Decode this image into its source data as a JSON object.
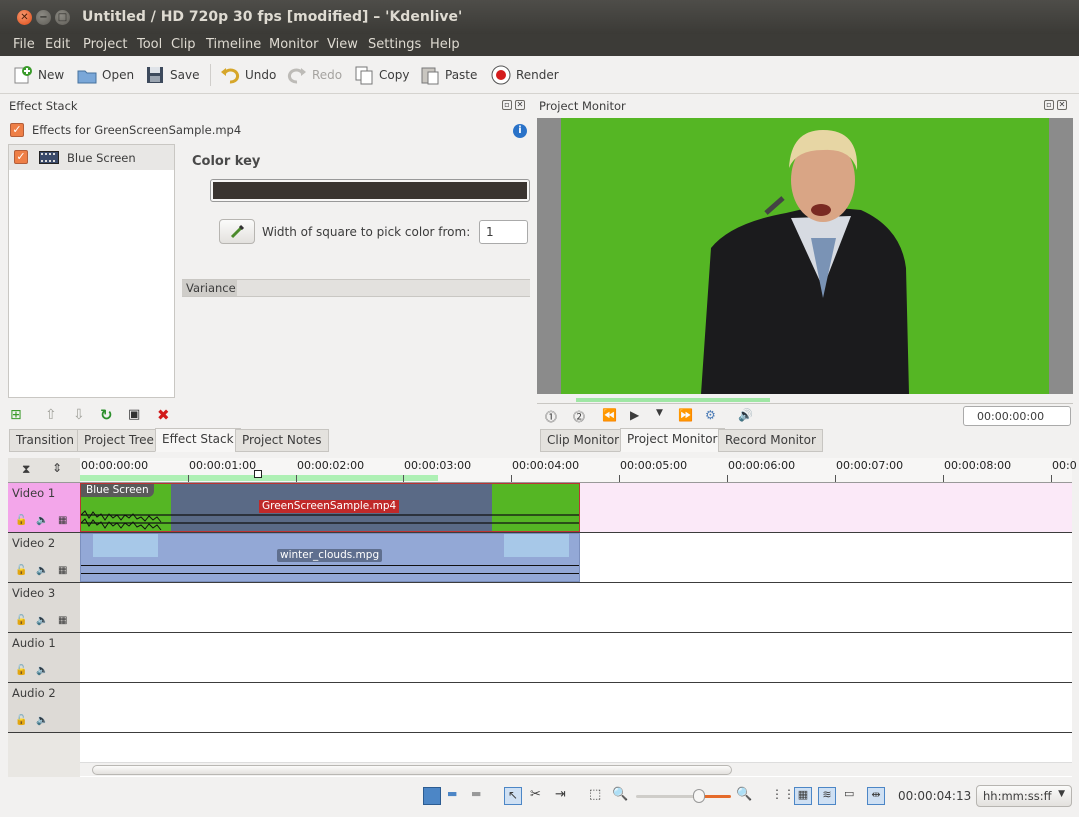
{
  "window": {
    "title": "Untitled / HD 720p 30 fps [modified] – 'Kdenlive'"
  },
  "menu": [
    "File",
    "Edit",
    "Project",
    "Tool",
    "Clip",
    "Timeline",
    "Monitor",
    "View",
    "Settings",
    "Help"
  ],
  "toolbar": {
    "new": "New",
    "open": "Open",
    "save": "Save",
    "undo": "Undo",
    "redo": "Redo",
    "copy": "Copy",
    "paste": "Paste",
    "render": "Render"
  },
  "effect_stack": {
    "title": "Effect Stack",
    "effects_for": "Effects for GreenScreenSample.mp4",
    "effect_item": "Blue Screen",
    "param_title": "Color key",
    "color_value": "#3a3430",
    "width_label": "Width of square to pick color from:",
    "width_value": "1",
    "variance_label": "Variance"
  },
  "project_monitor": {
    "title": "Project Monitor",
    "timecode": "00:00:00:00",
    "screen_color": "#55b624",
    "border_color": "#8b8b8b"
  },
  "left_tabs": [
    "Transition",
    "Project Tree",
    "Effect Stack",
    "Project Notes"
  ],
  "right_tabs": [
    "Clip Monitor",
    "Project Monitor",
    "Record Monitor"
  ],
  "ruler": [
    "00:00:00:00",
    "00:00:01:00",
    "00:00:02:00",
    "00:00:03:00",
    "00:00:04:00",
    "00:00:05:00",
    "00:00:06:00",
    "00:00:07:00",
    "00:00:08:00",
    "00:0"
  ],
  "tracks": [
    {
      "name": "Video 1"
    },
    {
      "name": "Video 2"
    },
    {
      "name": "Video 3"
    },
    {
      "name": "Audio 1"
    },
    {
      "name": "Audio 2"
    }
  ],
  "clips": {
    "effect_badge": "Blue Screen",
    "green_clip": "GreenScreenSample.mp4",
    "clouds_clip": "winter_clouds.mpg"
  },
  "statusbar": {
    "timecode": "00:00:04:13",
    "format": "hh:mm:ss:ff"
  }
}
